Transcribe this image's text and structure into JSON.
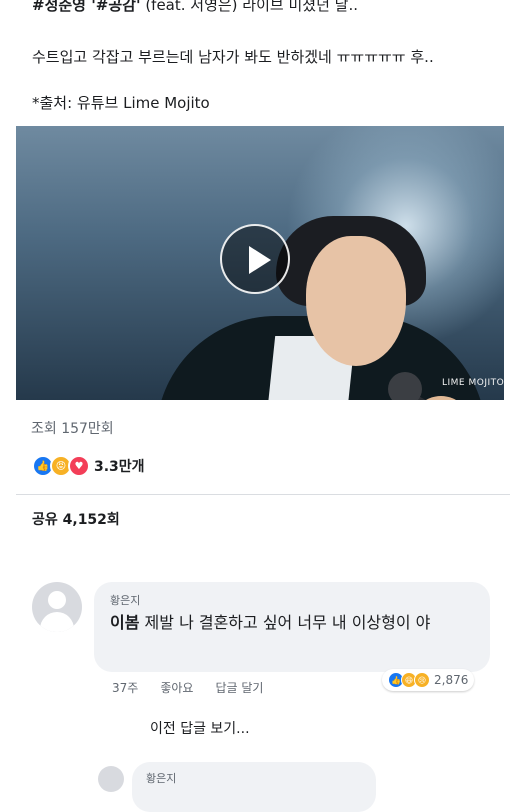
{
  "post": {
    "line1_hash": "#정준영 '#공감'",
    "line1_rest": " (feat. 서영은) 라이브 미쳤던 날..",
    "line2": "수트입고 각잡고 부르는데 남자가 봐도 반하겠네 ㅠㅠㅠㅠㅠ 후..",
    "line3": "*출처: 유튜브 Lime Mojito"
  },
  "video": {
    "watermark": "LIME MOJITO",
    "play_icon": "play-icon"
  },
  "stats": {
    "views": "조회 157만회",
    "reaction_count": "3.3만개",
    "reaction_icons": [
      "like-icon",
      "angry-icon",
      "love-icon"
    ],
    "shares": "공유 4,152회"
  },
  "comment": {
    "author": "황은지",
    "tag": "이봄",
    "text": " 제발 나 결혼하고 싶어 너무 내 이상형이 야",
    "time": "37주",
    "like_label": "좋아요",
    "reply_label": "답글 달기",
    "reaction_icons": [
      "like-icon",
      "haha-icon",
      "sad-icon"
    ],
    "reaction_count": "2,876"
  },
  "prev_replies_label": "이전 답글 보기...",
  "reply": {
    "author": "황은지"
  },
  "colors": {
    "accent": "#1877f2",
    "muted_text": "#606770",
    "bubble_bg": "#f0f2f5"
  }
}
